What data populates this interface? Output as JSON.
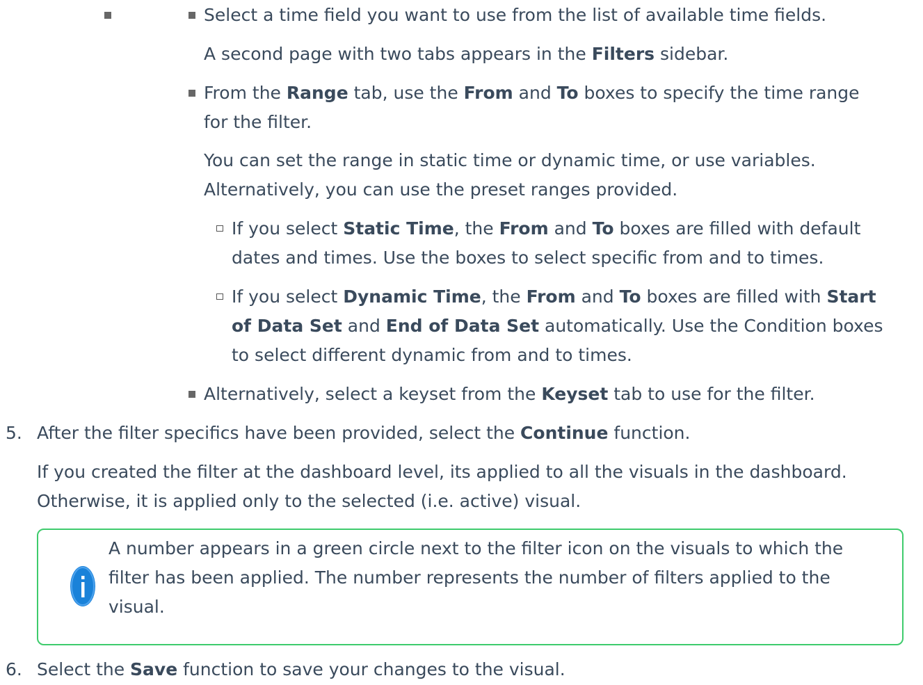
{
  "level2_bullet": "",
  "items": [
    {
      "text": "Select a time field you want to use from the list of available time fields."
    },
    {
      "pre": "A second page with two tabs appears in the ",
      "b1": "Filters",
      "post": " sidebar."
    },
    {
      "l1": [
        "From the ",
        "Range",
        " tab, use the ",
        "From",
        " and ",
        "To",
        " boxes to specify the time range"
      ],
      "l2": "for the filter."
    },
    {
      "l1": "You can set the range in static time or dynamic time, or use variables.",
      "l2": "Alternatively, you can use the preset ranges provided."
    },
    {
      "l1": [
        "If you select ",
        "Static Time",
        ", the ",
        "From",
        " and ",
        "To",
        " boxes are filled with default"
      ],
      "l2": "dates and times. Use the boxes to select specific from and to times."
    },
    {
      "l1": [
        "If you select ",
        "Dynamic Time",
        ", the ",
        "From",
        " and ",
        "To",
        " boxes are filled with ",
        "Start"
      ],
      "l2": [
        "of Data Set",
        " and ",
        "End of Data Set",
        " automatically. Use the Condition boxes"
      ],
      "l3": "to select different dynamic from and to times."
    },
    {
      "text": [
        "Alternatively, select a keyset from the ",
        "Keyset",
        " tab to use for the filter."
      ]
    }
  ],
  "step5": {
    "num": "5.",
    "text": [
      "After the filter specifics have been provided, select the ",
      "Continue",
      " function."
    ]
  },
  "step5_para": {
    "l1": "If you created the filter at the dashboard level, its applied to all the visuals in the dashboard.",
    "l2": "Otherwise, it is applied only to the selected (i.e. active) visual."
  },
  "note": {
    "icon": "info-icon",
    "l1": "A number appears in a green circle next to the filter icon on the visuals to which the",
    "l2": "filter has been applied. The number represents the number of filters applied to the",
    "l3": "visual.",
    "border_color": "#3ecb6c",
    "icon_color": "#1a82d9"
  },
  "step6": {
    "num": "6.",
    "text": [
      "Select the ",
      "Save",
      " function to save your changes to the visual."
    ]
  }
}
